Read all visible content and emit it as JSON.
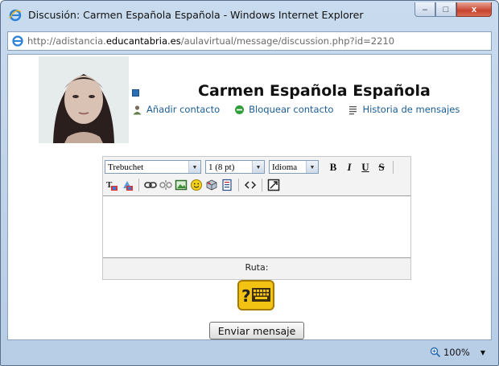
{
  "window": {
    "title": "Discusión: Carmen Española Española - Windows Internet Explorer",
    "minimize_label": "–",
    "maximize_label": "□",
    "close_label": "x"
  },
  "address": {
    "url_prefix": "http://adistancia.",
    "url_domain": "educantabria.es",
    "url_suffix": "/aulavirtual/message/discussion.php?id=2210"
  },
  "profile": {
    "name": "Carmen Española Española",
    "actions": {
      "add_contact": "Añadir contacto",
      "block_contact": "Bloquear contacto",
      "history": "Historia de mensajes"
    }
  },
  "editor": {
    "font_family": "Trebuchet",
    "font_size": "1 (8 pt)",
    "language": "Idioma",
    "format_buttons": [
      "B",
      "I",
      "U",
      "S"
    ],
    "path_label": "Ruta:",
    "content": ""
  },
  "send_button": "Enviar mensaje",
  "status": {
    "zoom": "100%"
  },
  "colors": {
    "link": "#1a5d96",
    "window_frame": "#b7cde6",
    "close_button": "#c8452f",
    "keyboard_help": "#f2c313"
  }
}
